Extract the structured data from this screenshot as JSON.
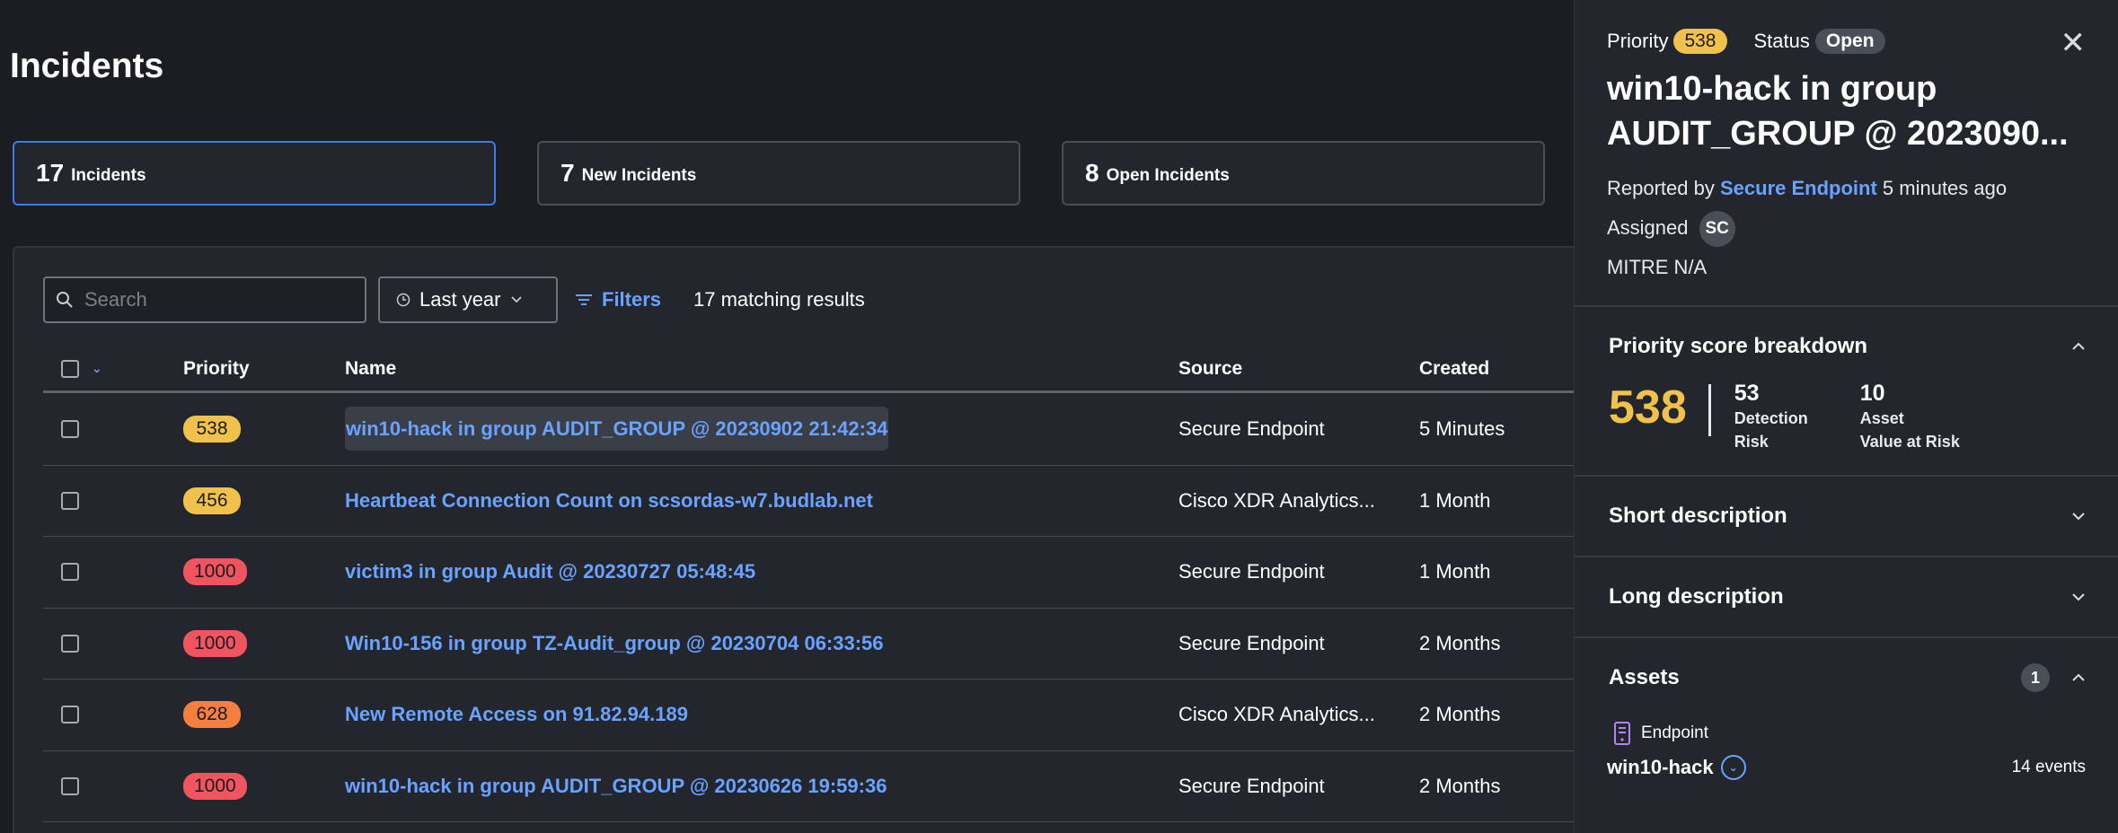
{
  "page": {
    "title": "Incidents"
  },
  "stats": [
    {
      "count": "17",
      "label": "Incidents"
    },
    {
      "count": "7",
      "label": "New Incidents"
    },
    {
      "count": "8",
      "label": "Open Incidents"
    }
  ],
  "toolbar": {
    "search_placeholder": "Search",
    "range_label": "Last year",
    "filters_label": "Filters",
    "results_text": "17 matching results"
  },
  "table": {
    "headers": {
      "priority": "Priority",
      "name": "Name",
      "source": "Source",
      "created": "Created"
    },
    "rows": [
      {
        "priority": "538",
        "priority_color": "#f0c14b",
        "name": "win10-hack in group AUDIT_GROUP @ 20230902 21:42:34",
        "source": "Secure Endpoint",
        "created": "5 Minutes"
      },
      {
        "priority": "456",
        "priority_color": "#f0c14b",
        "name": "Heartbeat Connection Count on scsordas-w7.budlab.net",
        "source": "Cisco XDR Analytics...",
        "created": "1 Month"
      },
      {
        "priority": "1000",
        "priority_color": "#f0545e",
        "name": "victim3 in group Audit @ 20230727 05:48:45",
        "source": "Secure Endpoint",
        "created": "1 Month"
      },
      {
        "priority": "1000",
        "priority_color": "#f0545e",
        "name": "Win10-156 in group TZ-Audit_group @ 20230704 06:33:56",
        "source": "Secure Endpoint",
        "created": "2 Months"
      },
      {
        "priority": "628",
        "priority_color": "#f57f3f",
        "name": "New Remote Access on 91.82.94.189",
        "source": "Cisco XDR Analytics...",
        "created": "2 Months"
      },
      {
        "priority": "1000",
        "priority_color": "#f0545e",
        "name": "win10-hack in group AUDIT_GROUP @ 20230626 19:59:36",
        "source": "Secure Endpoint",
        "created": "2 Months"
      }
    ]
  },
  "drawer": {
    "priority_label": "Priority",
    "priority_value": "538",
    "status_label": "Status",
    "status_value": "Open",
    "title": "win10-hack in group AUDIT_GROUP @ 2023090...",
    "reported_prefix": "Reported by",
    "reported_by": "Secure Endpoint",
    "reported_time": "5 minutes ago",
    "assigned_label": "Assigned",
    "assigned_initials": "SC",
    "mitre": "MITRE N/A",
    "breakdown": {
      "title": "Priority score breakdown",
      "total": "538",
      "detection_value": "53",
      "detection_label_1": "Detection",
      "detection_label_2": "Risk",
      "asset_value": "10",
      "asset_label_1": "Asset",
      "asset_label_2": "Value at Risk"
    },
    "short_desc_title": "Short description",
    "long_desc_title": "Long description",
    "assets": {
      "title": "Assets",
      "count": "1",
      "type": "Endpoint",
      "name": "win10-hack",
      "events": "14 events"
    }
  }
}
